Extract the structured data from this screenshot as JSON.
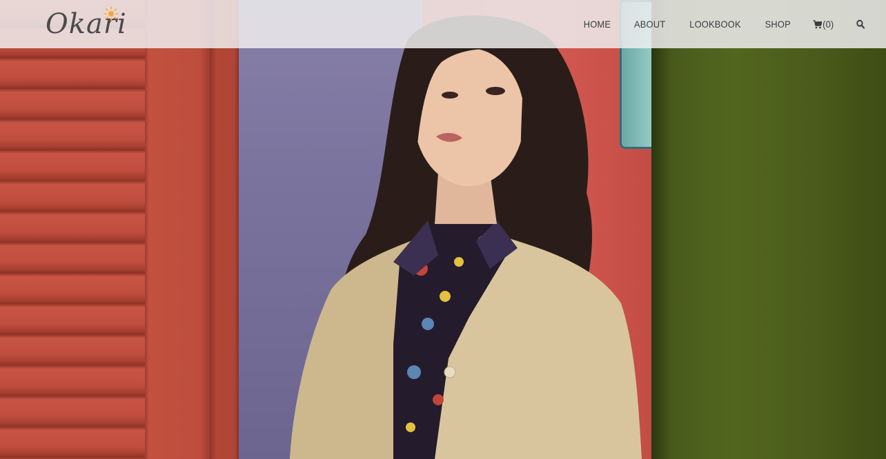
{
  "site": {
    "logo_text": "Okari",
    "logo_icon": "sun-icon"
  },
  "nav": {
    "home_label": "HOME",
    "about_label": "ABOUT",
    "lookbook_label": "LOOKBOOK",
    "shop_label": "SHOP",
    "cart_icon": "cart-icon",
    "cart_count": "(0)",
    "search_icon": "search-icon"
  },
  "hero": {
    "image_alt": "Model with long dark hair wearing a beige jacket over a patterned shirt"
  },
  "colors": {
    "navbar_bg": "#eeecee",
    "nav_text": "#3b3b3b",
    "logo_text": "#4a4a4a",
    "logo_sun": "#f2a93b"
  }
}
